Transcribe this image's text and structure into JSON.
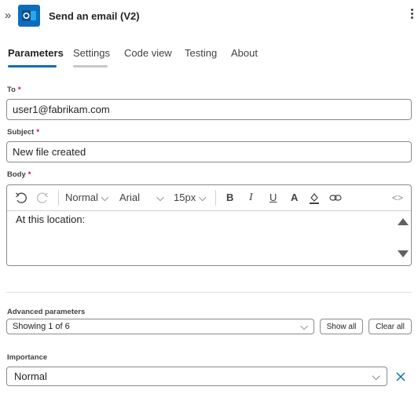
{
  "header": {
    "title": "Send an email (V2)",
    "app_color": "#0f6cbd"
  },
  "tabs": [
    {
      "label": "Parameters",
      "active": true
    },
    {
      "label": "Settings",
      "active": false
    },
    {
      "label": "Code view",
      "active": false
    },
    {
      "label": "Testing",
      "active": false
    },
    {
      "label": "About",
      "active": false
    }
  ],
  "fields": {
    "to": {
      "label": "To",
      "required_mark": "*",
      "value": "user1@fabrikam.com"
    },
    "subject": {
      "label": "Subject",
      "required_mark": "*",
      "value": "New file created"
    },
    "body": {
      "label": "Body",
      "required_mark": "*",
      "value": "At this location:"
    }
  },
  "editor_toolbar": {
    "paragraph_style": "Normal",
    "font_family": "Arial",
    "font_size": "15px",
    "bold": "B",
    "italic": "I",
    "underline": "U",
    "font_color": "A",
    "code_view": "<>"
  },
  "advanced": {
    "label": "Advanced parameters",
    "selected": "Showing 1 of 6",
    "show_all": "Show all",
    "clear_all": "Clear all"
  },
  "importance": {
    "label": "Importance",
    "value": "Normal"
  },
  "colors": {
    "accent": "#0f6cbd",
    "required": "#c50f1f",
    "inactive_underline": "#c8c8c8"
  }
}
